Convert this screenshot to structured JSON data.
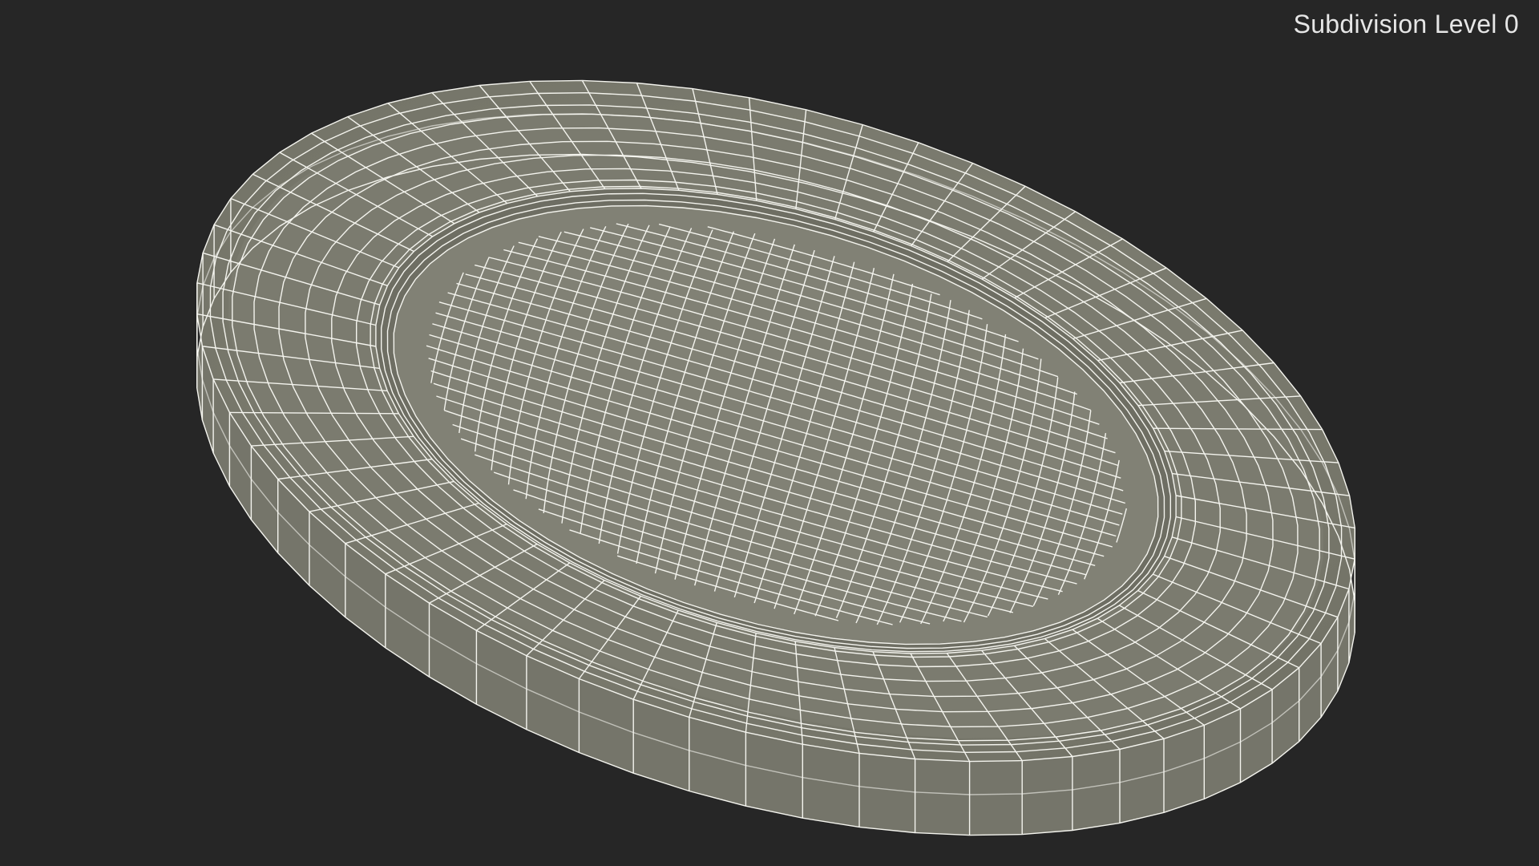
{
  "viewport": {
    "subdivision_label": "Subdivision Level 0",
    "background_color": "#262626",
    "surface_color": "#7f7f74",
    "wire_color": "#f4f4ee"
  }
}
